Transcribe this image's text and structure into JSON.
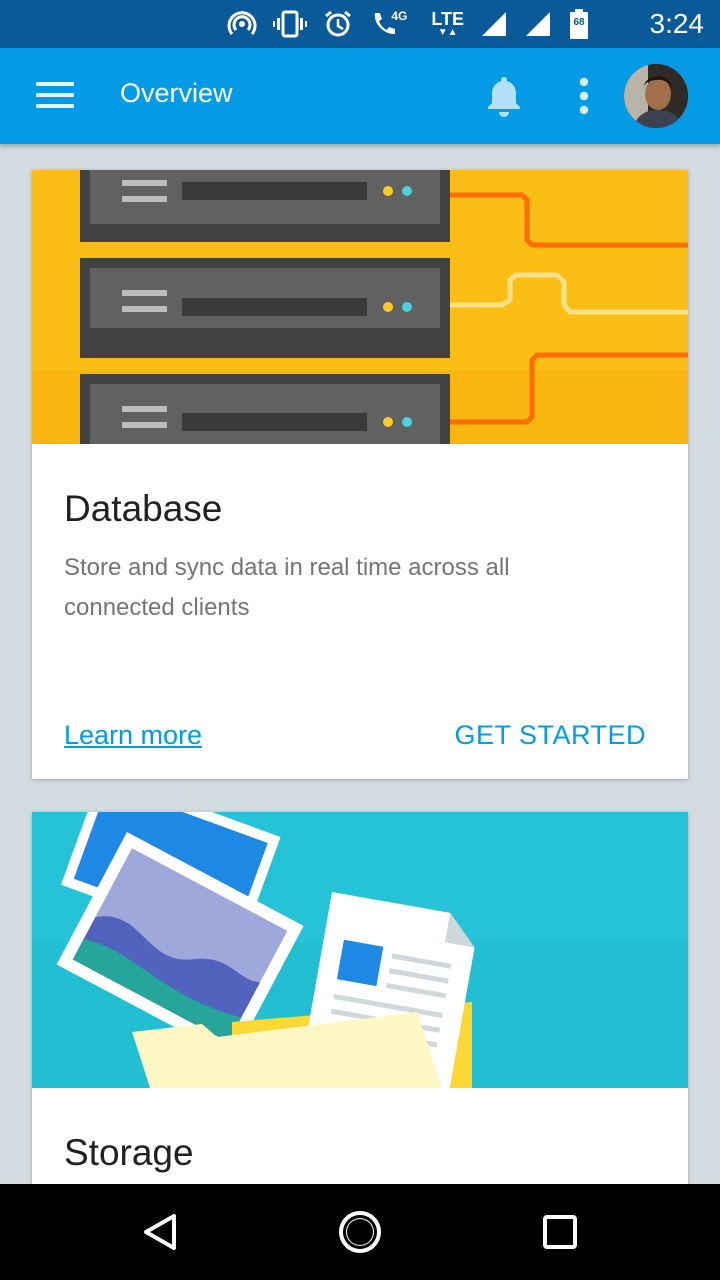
{
  "status_bar": {
    "time": "3:24",
    "network_label": "LTE",
    "network_sub": "4G",
    "battery": "68",
    "icons": [
      "hotspot-icon",
      "vibrate-icon",
      "alarm-icon",
      "wifi-calling-icon",
      "lte-icon",
      "signal-icon",
      "signal-icon",
      "battery-icon"
    ]
  },
  "app_bar": {
    "title": "Overview",
    "icons": [
      "menu-icon",
      "notifications-bell-icon",
      "more-vert-icon",
      "avatar"
    ]
  },
  "cards": [
    {
      "title": "Database",
      "description": "Store and sync data in real time across all connected clients",
      "learn_more": "Learn more",
      "action": "GET STARTED",
      "colors": {
        "hero_bg": "#fbbe14",
        "server": "#4a4a4a",
        "wire": "#ff6d00"
      }
    },
    {
      "title": "Storage",
      "colors": {
        "hero_bg": "#24c3d8",
        "folder": "#fff8c4",
        "photo": "#7986cb"
      }
    }
  ],
  "nav_bar": {
    "icons": [
      "back-icon",
      "home-icon",
      "recents-icon"
    ]
  },
  "colors": {
    "status_bar": "#0a5a9a",
    "app_bar": "#039be5",
    "background": "#d4dde2",
    "accent": "#039be5"
  }
}
